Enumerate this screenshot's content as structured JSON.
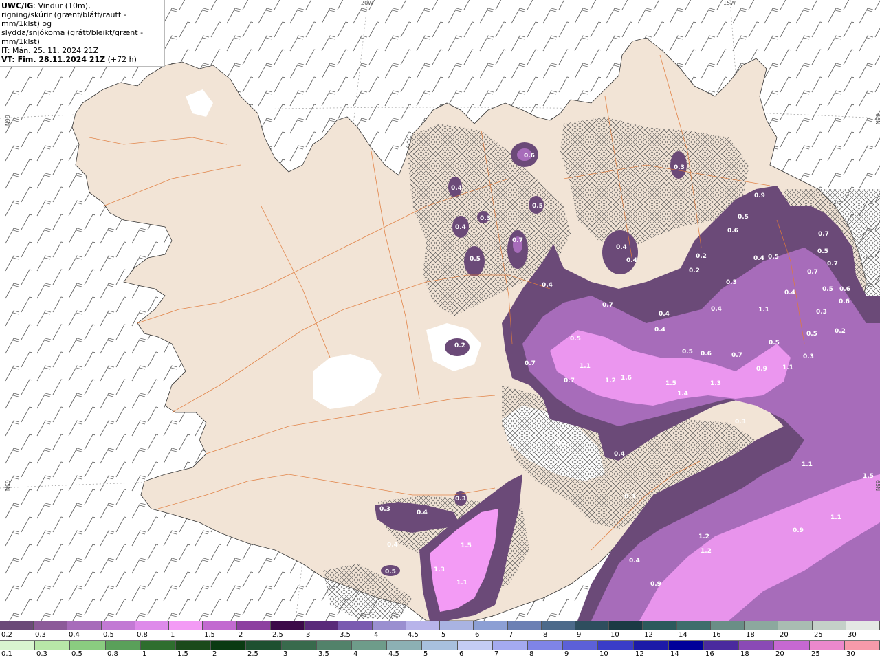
{
  "header": {
    "product": "UWC/IG",
    "line1_rest": ": Vindur (10m),",
    "line2": "rigning/skúrir (grænt/blátt/rautt - mm/1klst) og",
    "line3": "slydda/snjókoma (grátt/bleikt/grænt - mm/1klst)",
    "line4": "IT: Mán. 25. 11. 2024 21Z",
    "line5_bold": "VT: Fim. 28.11.2024 21Z",
    "line5_rest": " (+72 h)"
  },
  "grid_labels": {
    "lon_20w": "20W",
    "lon_15w": "15W",
    "lat_66n_left": "66N",
    "lat_66n_right": "66N",
    "lat_65n_left": "65N",
    "lat_65n_right": "65N"
  },
  "map_values": [
    {
      "v": "0.6"
    },
    {
      "v": "0.3"
    },
    {
      "v": "0.4"
    },
    {
      "v": "0.5"
    },
    {
      "v": "0.4"
    },
    {
      "v": "0.3"
    },
    {
      "v": "0.7"
    },
    {
      "v": "0.5"
    },
    {
      "v": "0.4"
    },
    {
      "v": "0.4"
    },
    {
      "v": "0.9"
    },
    {
      "v": "0.5"
    },
    {
      "v": "0.6"
    },
    {
      "v": "0.7"
    },
    {
      "v": "0.5"
    },
    {
      "v": "0.7"
    },
    {
      "v": "0.4"
    },
    {
      "v": "0.2"
    },
    {
      "v": "0.2"
    },
    {
      "v": "0.3"
    },
    {
      "v": "0.4"
    },
    {
      "v": "0.5"
    },
    {
      "v": "0.7"
    },
    {
      "v": "0.5"
    },
    {
      "v": "0.6"
    },
    {
      "v": "0.4"
    },
    {
      "v": "0.7"
    },
    {
      "v": "0.4"
    },
    {
      "v": "0.4"
    },
    {
      "v": "1.1"
    },
    {
      "v": "0.3"
    },
    {
      "v": "0.4"
    },
    {
      "v": "0.5"
    },
    {
      "v": "0.2"
    },
    {
      "v": "0.2"
    },
    {
      "v": "0.5"
    },
    {
      "v": "0.6"
    },
    {
      "v": "0.7"
    },
    {
      "v": "0.5"
    },
    {
      "v": "0.3"
    },
    {
      "v": "0.7"
    },
    {
      "v": "1.1"
    },
    {
      "v": "1.2"
    },
    {
      "v": "1.6"
    },
    {
      "v": "1.5"
    },
    {
      "v": "1.4"
    },
    {
      "v": "1.3"
    },
    {
      "v": "0.5"
    },
    {
      "v": "0.7"
    },
    {
      "v": "0.9"
    },
    {
      "v": "1.1"
    },
    {
      "v": "0.3"
    },
    {
      "v": "0.2"
    },
    {
      "v": "0.4"
    },
    {
      "v": "0.3"
    },
    {
      "v": "0.4"
    },
    {
      "v": "0.3"
    },
    {
      "v": "0.4"
    },
    {
      "v": "1.5"
    },
    {
      "v": "1.3"
    },
    {
      "v": "1.1"
    },
    {
      "v": "0.5"
    },
    {
      "v": "0.3"
    },
    {
      "v": "1.1"
    },
    {
      "v": "1.5"
    },
    {
      "v": "1.1"
    },
    {
      "v": "0.9"
    },
    {
      "v": "1.2"
    },
    {
      "v": "1.2"
    },
    {
      "v": "0.4"
    },
    {
      "v": "0.9"
    },
    {
      "v": "0.6"
    }
  ],
  "legend_snow": {
    "labels": [
      "0.2",
      "0.3",
      "0.4",
      "0.5",
      "0.8",
      "1",
      "1.5",
      "2",
      "2.5",
      "3",
      "3.5",
      "4",
      "4.5",
      "5",
      "6",
      "7",
      "8",
      "9",
      "10",
      "12",
      "14",
      "16",
      "18",
      "20",
      "25",
      "30"
    ],
    "colors": [
      "#6b4a78",
      "#8c5a99",
      "#a76cba",
      "#c279d4",
      "#de8aea",
      "#f39bf5",
      "#c26ad0",
      "#8d40a0",
      "#3c0a48",
      "#5a2a7a",
      "#7a5ab0",
      "#9a8fd0",
      "#b8b4ea",
      "#a9b3e2",
      "#8c9fd4",
      "#6c80b4",
      "#4c6a8a",
      "#2e4e5e",
      "#1b3a44",
      "#2c5a5c",
      "#3e6e6c",
      "#6a8e86",
      "#8ca89e",
      "#a9bcb2",
      "#c4d0c8",
      "#e4e8e4"
    ]
  },
  "legend_rain": {
    "labels": [
      "0.1",
      "0.3",
      "0.5",
      "0.8",
      "1",
      "1.5",
      "2",
      "2.5",
      "3",
      "3.5",
      "4",
      "4.5",
      "5",
      "6",
      "7",
      "8",
      "9",
      "10",
      "12",
      "14",
      "16",
      "18",
      "20",
      "25",
      "30"
    ],
    "colors": [
      "#d9f5d0",
      "#b8e6a8",
      "#8acc80",
      "#5aa05a",
      "#2e6e2e",
      "#1b4a1b",
      "#0a3a12",
      "#1e5030",
      "#386a4c",
      "#52826a",
      "#6e9c8a",
      "#8cb0b4",
      "#a8c0de",
      "#c4ccf4",
      "#a4aaf0",
      "#7f84e6",
      "#5c60d8",
      "#3a3cc8",
      "#1c1aa8",
      "#00009a",
      "#4a2a9e",
      "#8a4ab6",
      "#c668d2",
      "#ec88cc",
      "#f79aaa",
      "#f5666a",
      "#ee2222"
    ]
  },
  "colors": {
    "land": "#f2e4d6",
    "roads": "#e07a3a",
    "snow_light": "#f39bf5",
    "snow_mid": "#c06bcc",
    "snow_dark": "#6b4a78",
    "rain_green": "#1e5a2a"
  }
}
